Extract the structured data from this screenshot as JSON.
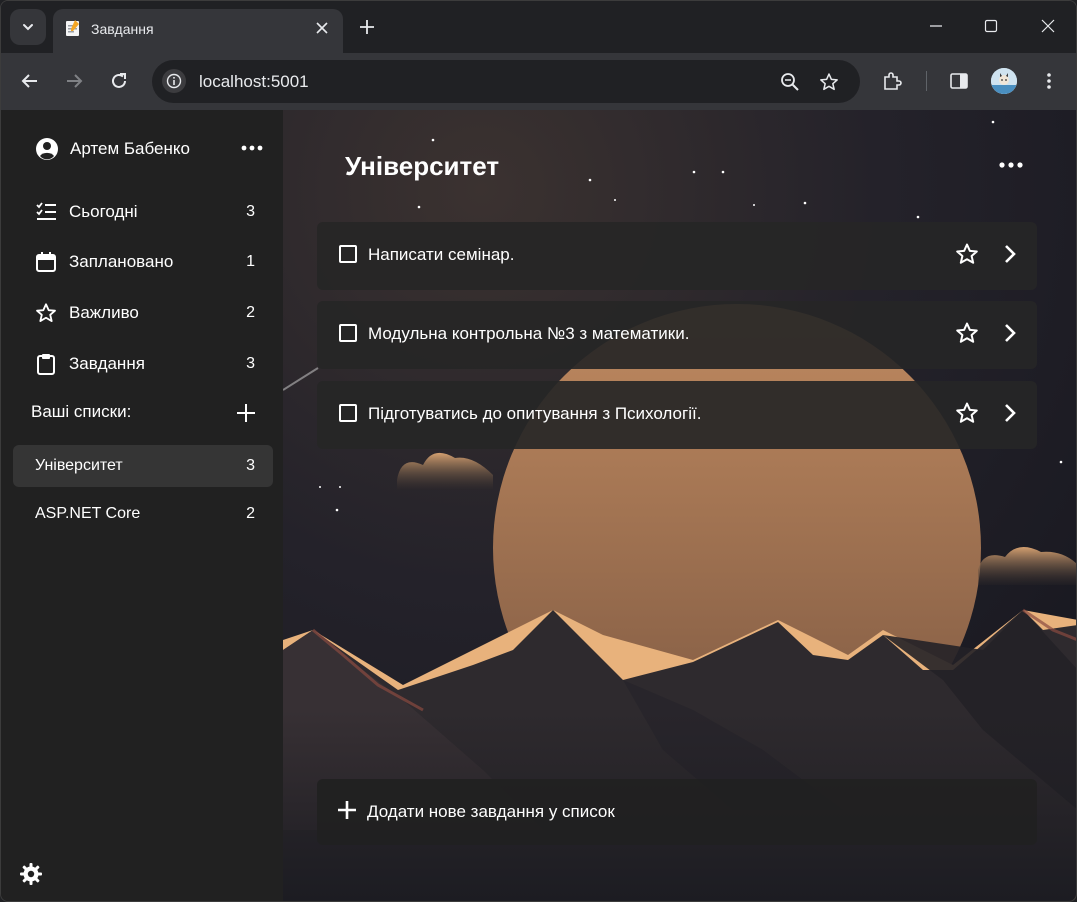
{
  "browser": {
    "tab_title": "Завдання",
    "url": "localhost:5001"
  },
  "user": {
    "name": "Артем Бабенко"
  },
  "nav": [
    {
      "label": "Сьогодні",
      "count": "3",
      "icon": "checklist-icon"
    },
    {
      "label": "Заплановано",
      "count": "1",
      "icon": "calendar-icon"
    },
    {
      "label": "Важливо",
      "count": "2",
      "icon": "star-icon"
    },
    {
      "label": "Завдання",
      "count": "3",
      "icon": "clipboard-icon"
    }
  ],
  "lists_heading": "Ваші списки:",
  "lists": [
    {
      "label": "Університет",
      "count": "3",
      "active": true
    },
    {
      "label": "ASP.NET Core",
      "count": "2",
      "active": false
    }
  ],
  "main": {
    "title": "Університет",
    "tasks": [
      {
        "title": "Написати семінар."
      },
      {
        "title": "Модульна контрольна №3 з математики."
      },
      {
        "title": "Підготуватись до опитування з Психології."
      }
    ],
    "add_task_label": "Додати нове завдання у список"
  },
  "colors": {
    "sidebar_bg": "#212121",
    "active_list_bg": "#353535",
    "sun": "#b8825f",
    "mountain_light": "#e8b27c"
  }
}
